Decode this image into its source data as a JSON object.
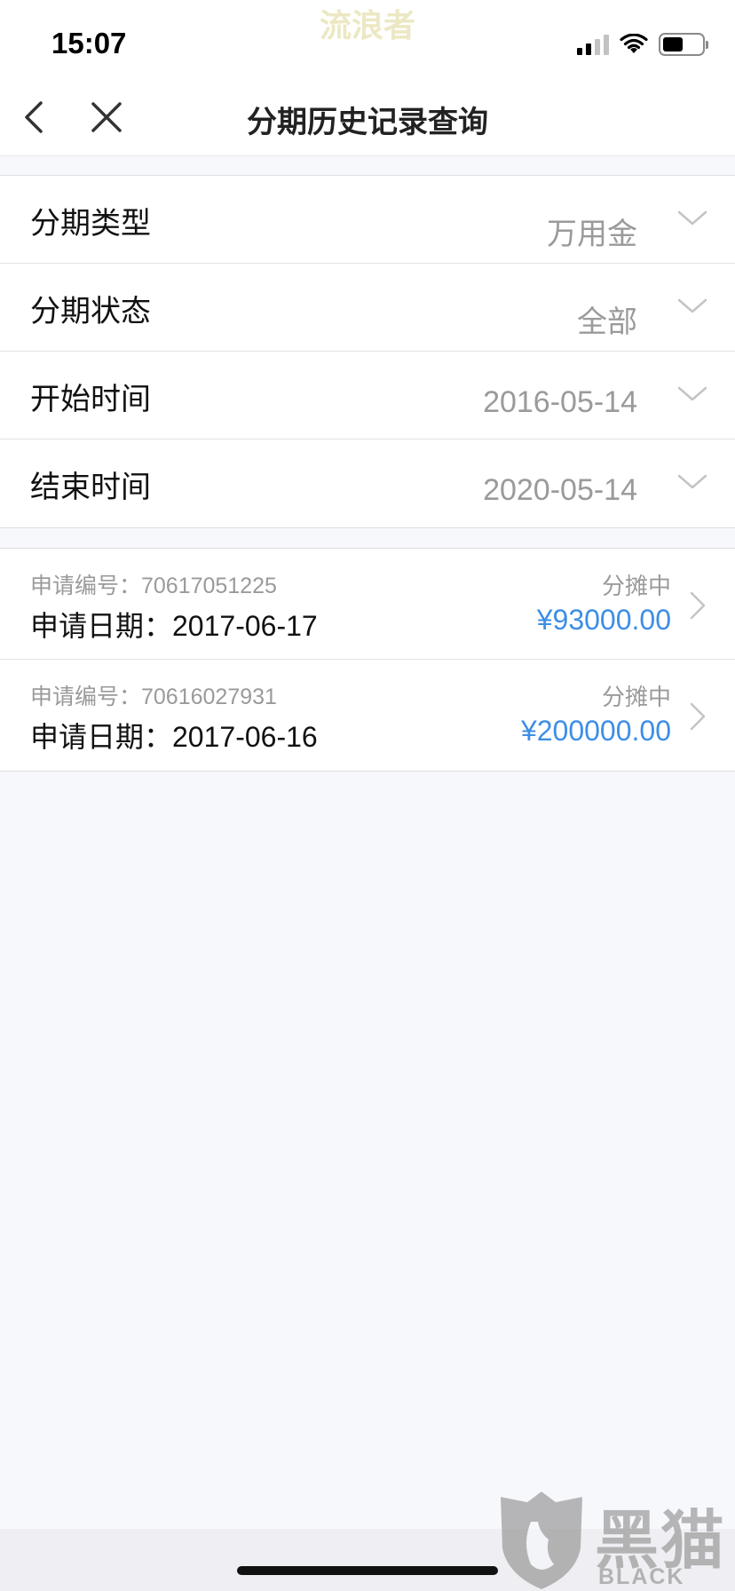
{
  "status_bar": {
    "time": "15:07",
    "watermark": "流浪者"
  },
  "nav": {
    "title": "分期历史记录查询",
    "back_icon": "chevron-left-icon",
    "close_icon": "close-icon"
  },
  "filters": [
    {
      "label": "分期类型",
      "value": "万用金"
    },
    {
      "label": "分期状态",
      "value": "全部"
    },
    {
      "label": "开始时间",
      "value": "2016-05-14"
    },
    {
      "label": "结束时间",
      "value": "2020-05-14"
    }
  ],
  "records": [
    {
      "application_no": "申请编号：70617051225",
      "application_date": "申请日期：2017-06-17",
      "status": "分摊中",
      "amount": "¥93000.00"
    },
    {
      "application_no": "申请编号：70616027931",
      "application_date": "申请日期：2017-06-16",
      "status": "分摊中",
      "amount": "¥200000.00"
    }
  ],
  "watermark_logo": {
    "cn": "黑猫",
    "en": "BLACK CAT"
  },
  "colors": {
    "accent": "#3d8ee6",
    "background": "#f7f8fc",
    "muted_text": "#9a9a9a"
  }
}
